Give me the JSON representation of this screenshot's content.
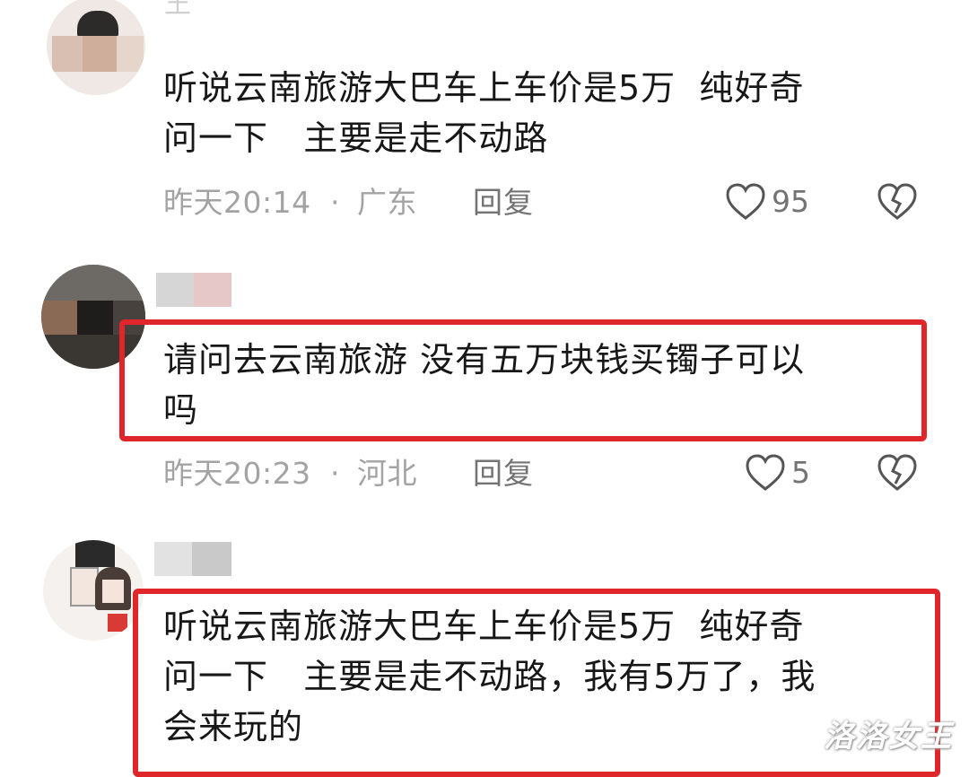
{
  "comments": [
    {
      "username": "王",
      "text": "听说云南旅游大巴车上车价是5万  纯好奇\n问一下   主要是走不动路",
      "time": "昨天20:14",
      "location": "广东",
      "reply_label": "回复",
      "likes": "95",
      "highlighted": false
    },
    {
      "text": "请问去云南旅游 没有五万块钱买镯子可以\n吗",
      "time": "昨天20:23",
      "location": "河北",
      "reply_label": "回复",
      "likes": "5",
      "highlighted": true
    },
    {
      "text": "听说云南旅游大巴车上车价是5万  纯好奇\n问一下   主要是走不动路，我有5万了，我\n会来玩的",
      "highlighted": true
    }
  ],
  "separator": "·",
  "watermark": "洛洛女王",
  "colors": {
    "highlight": "#e0262b",
    "meta": "#a3a3a3",
    "text": "#171717"
  }
}
